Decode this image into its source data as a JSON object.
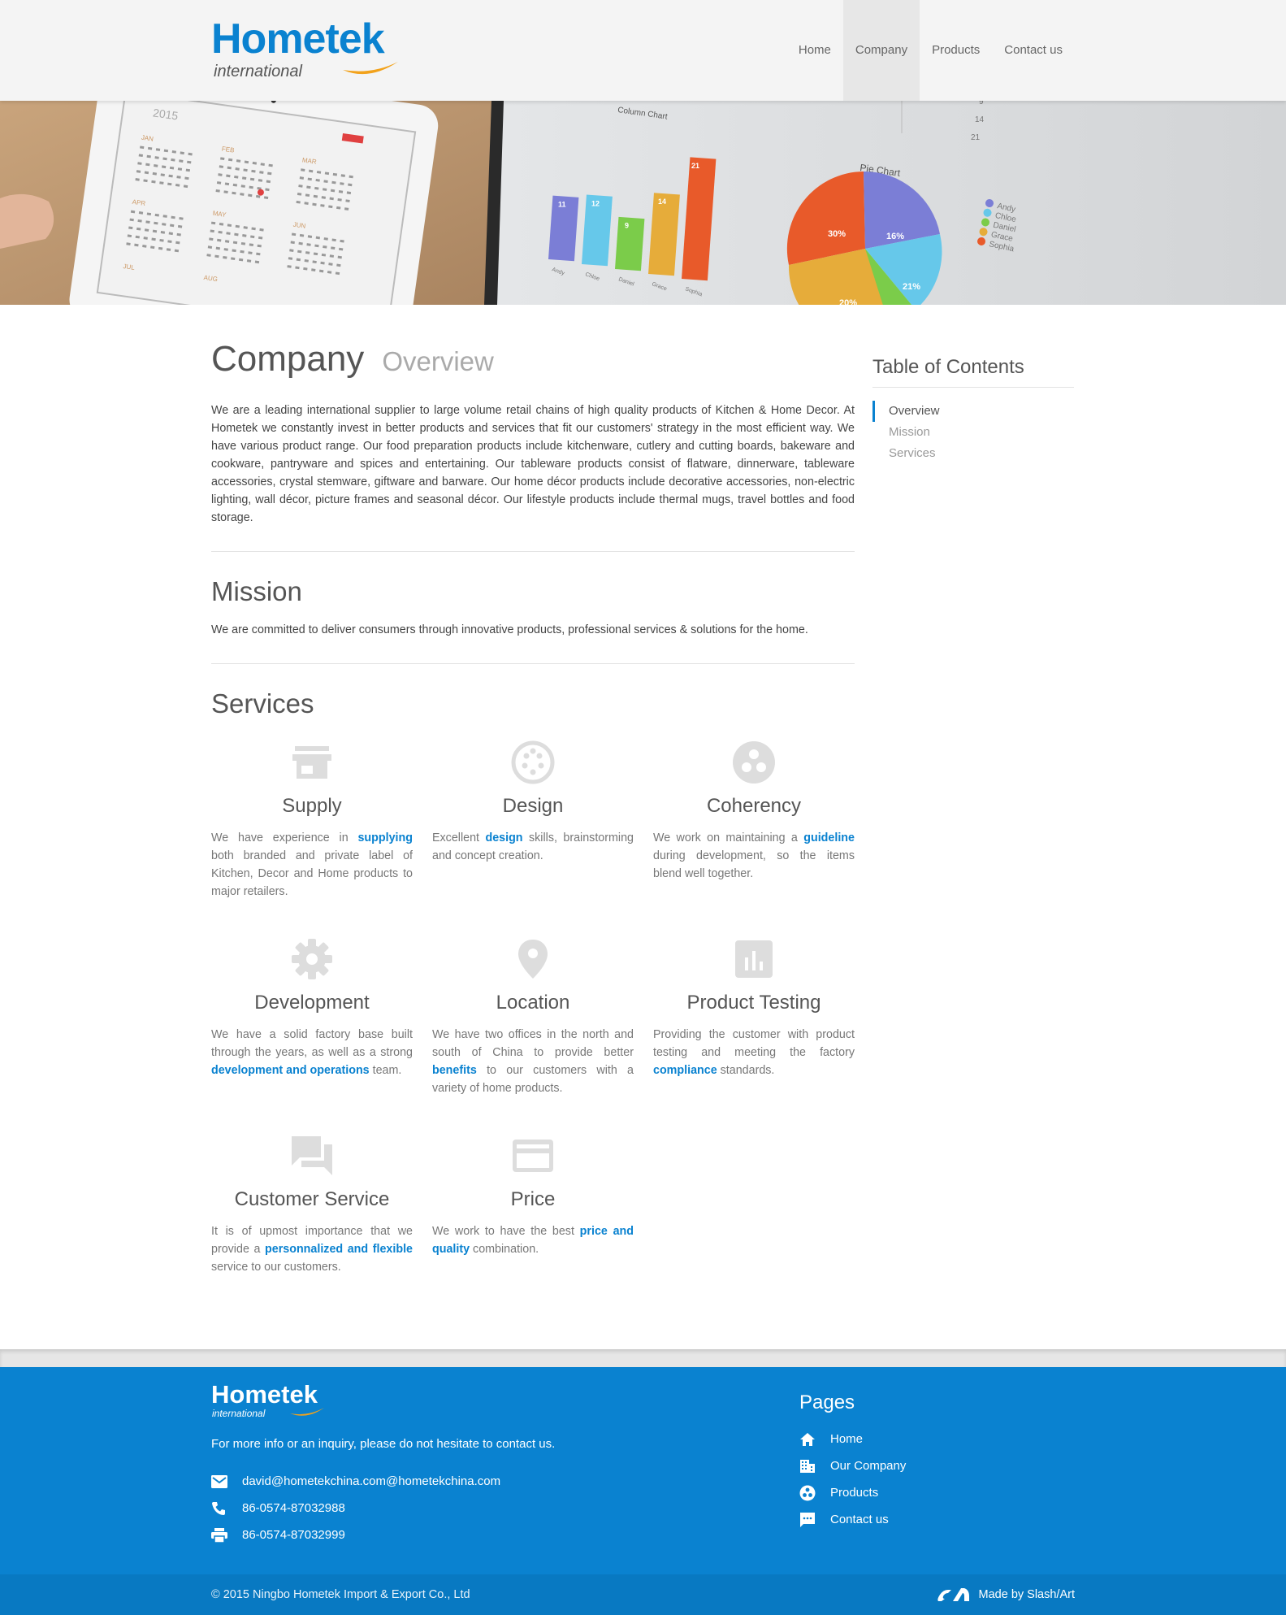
{
  "brand": {
    "name": "Hometek",
    "tagline": "international",
    "accent": "#0a82d0",
    "swoosh": "#f2a21b"
  },
  "nav": {
    "items": [
      {
        "label": "Home",
        "active": false
      },
      {
        "label": "Company",
        "active": true
      },
      {
        "label": "Products",
        "active": false
      },
      {
        "label": "Contact us",
        "active": false
      }
    ]
  },
  "hero": {
    "tablet_year": "2015",
    "months": [
      "JAN",
      "FEB",
      "MAR",
      "APR",
      "MAY",
      "JUN",
      "JUL",
      "AUG"
    ],
    "column_chart": {
      "title": "Column Chart",
      "categories": [
        "Andy",
        "Chloe",
        "Daniel",
        "Grace",
        "Sophia"
      ],
      "values": [
        11,
        12,
        9,
        14,
        21
      ]
    },
    "pie_chart": {
      "title": "Pie Chart",
      "labels": [
        "30%",
        "16%",
        "21%",
        "20%"
      ],
      "legend": [
        "Andy",
        "Chloe",
        "Daniel",
        "Grace",
        "Sophia"
      ]
    },
    "table_numbers": [
      "9",
      "14",
      "21"
    ]
  },
  "page": {
    "title": "Company",
    "subtitle": "Overview",
    "overview": "We are a leading international supplier to large volume retail chains of high quality products of Kitchen & Home Decor. At Hometek we constantly invest in better products and services that fit our customers' strategy in the most efficient way. We have various product range. Our food preparation products include kitchenware, cutlery and cutting boards, bakeware and cookware, pantryware and spices and entertaining. Our tableware products consist of flatware, dinnerware, tableware accessories, crystal stemware, giftware and barware. Our home décor products include decorative accessories, non-electric lighting, wall décor, picture frames and seasonal décor. Our lifestyle products include thermal mugs, travel bottles and food storage.",
    "mission_title": "Mission",
    "mission_text": "We are committed to deliver consumers through innovative products, professional services & solutions for the home.",
    "services_title": "Services"
  },
  "services": [
    {
      "title": "Supply",
      "icon": "store-icon",
      "before": "We have experience in ",
      "link": "supplying",
      "after": " both branded and private label of Kitchen, Decor and Home products to major retailers."
    },
    {
      "title": "Design",
      "icon": "palette-icon",
      "before": "Excellent ",
      "link": "design",
      "after": " skills, brainstorming and concept creation."
    },
    {
      "title": "Coherency",
      "icon": "bubbles-icon",
      "before": "We work on maintaining a ",
      "link": "guideline",
      "after": " during development, so the items blend well together."
    },
    {
      "title": "Development",
      "icon": "gear-icon",
      "before": "We have a solid factory base built through the years, as well as a strong ",
      "link": "development and operations",
      "after": " team."
    },
    {
      "title": "Location",
      "icon": "location-pin-icon",
      "before": "We have two offices in the north and south of China to provide better ",
      "link": "benefits",
      "after": " to our customers with a variety of home products."
    },
    {
      "title": "Product Testing",
      "icon": "bar-chart-icon",
      "before": "Providing the customer with product testing and meeting the factory ",
      "link": "compliance",
      "after": " standards."
    },
    {
      "title": "Customer Service",
      "icon": "chat-icon",
      "before": "It is of upmost importance that we provide a ",
      "link": "personnalized and flexible",
      "after": " service to our customers."
    },
    {
      "title": "Price",
      "icon": "credit-card-icon",
      "before": "We work to have the best ",
      "link": "price and quality",
      "after": " combination."
    }
  ],
  "toc": {
    "title": "Table of Contents",
    "items": [
      {
        "label": "Overview",
        "active": true
      },
      {
        "label": "Mission",
        "active": false
      },
      {
        "label": "Services",
        "active": false
      }
    ]
  },
  "footer": {
    "intro": "For more info or an inquiry, please do not hesitate to contact us.",
    "email": "david@hometekchina.com@hometekchina.com",
    "phone": "86-0574-87032988",
    "fax": "86-0574-87032999",
    "pages_title": "Pages",
    "pages": [
      {
        "label": "Home",
        "icon": "home-icon"
      },
      {
        "label": "Our Company",
        "icon": "building-icon"
      },
      {
        "label": "Products",
        "icon": "bubbles-icon"
      },
      {
        "label": "Contact us",
        "icon": "chat-icon"
      }
    ],
    "copyright": "© 2015 Ningbo Hometek Import & Export Co., Ltd",
    "made_by": "Made by Slash/Art",
    "footer_color": "#0a82d0"
  }
}
